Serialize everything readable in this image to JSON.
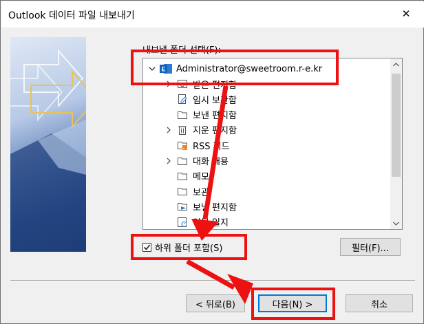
{
  "window": {
    "title": "Outlook 데이터 파일 내보내기",
    "close_glyph": "✕"
  },
  "folder_picker": {
    "label": "내보낼 폴더 선택(F):",
    "root": "Administrator@sweetroom.r-e.kr",
    "items": [
      {
        "label": "받은 편지함",
        "icon": "inbox-icon",
        "expandable": true
      },
      {
        "label": "임시 보관함",
        "icon": "drafts-icon",
        "expandable": false
      },
      {
        "label": "보낸 편지함",
        "icon": "folder-icon",
        "expandable": false
      },
      {
        "label": "지운 편지함",
        "icon": "trash-icon",
        "expandable": true
      },
      {
        "label": "RSS 피드",
        "icon": "rss-icon",
        "expandable": false
      },
      {
        "label": "대화 내용",
        "icon": "folder-icon",
        "expandable": true
      },
      {
        "label": "메모",
        "icon": "folder-icon",
        "expandable": false
      },
      {
        "label": "보관",
        "icon": "folder-icon",
        "expandable": false
      },
      {
        "label": "보낼 편지함",
        "icon": "outbox-icon",
        "expandable": false
      },
      {
        "label": "업무 일지",
        "icon": "journal-icon",
        "expandable": false
      }
    ]
  },
  "include_subfolders": {
    "label": "하위 폴더 포함(S)",
    "checked": true
  },
  "buttons": {
    "filter": "필터(F)...",
    "back": "< 뒤로(B)",
    "next": "다음(N) >",
    "cancel": "취소"
  },
  "colors": {
    "annotation_red": "#ee1111",
    "outlook_blue": "#0f62b6",
    "focus_blue": "#0078d7"
  }
}
